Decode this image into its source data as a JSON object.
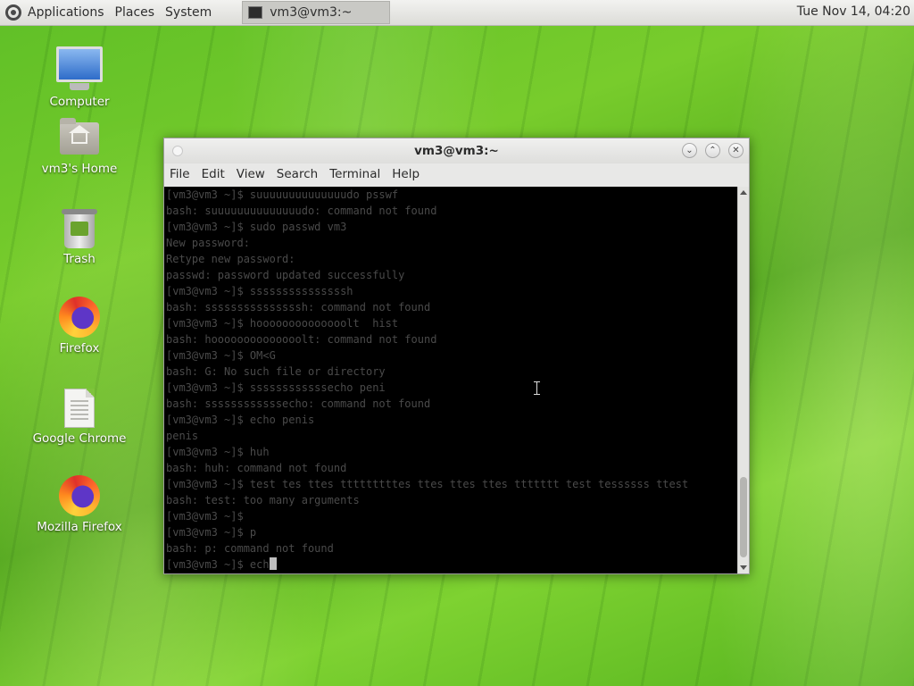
{
  "panel": {
    "menus": [
      "Applications",
      "Places",
      "System"
    ],
    "task_title": "vm3@vm3:~",
    "clock": "Tue Nov 14, 04:20"
  },
  "desktop": {
    "icons": [
      {
        "label": "Computer",
        "icon": "computer-icon"
      },
      {
        "label": "vm3's Home",
        "icon": "home-folder-icon"
      },
      {
        "label": "Trash",
        "icon": "trash-icon"
      },
      {
        "label": "Firefox",
        "icon": "firefox-icon"
      },
      {
        "label": "Google Chrome",
        "icon": "document-icon"
      },
      {
        "label": "Mozilla Firefox",
        "icon": "firefox-icon"
      }
    ]
  },
  "terminal": {
    "title": "vm3@vm3:~",
    "menu": [
      "File",
      "Edit",
      "View",
      "Search",
      "Terminal",
      "Help"
    ],
    "lines": [
      "[vm3@vm3 ~]$ suuuuuuuuuuuuuudo psswf",
      "bash: suuuuuuuuuuuuuudo: command not found",
      "[vm3@vm3 ~]$ sudo passwd vm3",
      "New password:",
      "Retype new password:",
      "passwd: password updated successfully",
      "[vm3@vm3 ~]$ sssssssssssssssh",
      "bash: sssssssssssssssh: command not found",
      "[vm3@vm3 ~]$ hoooooooooooooolt  hist",
      "bash: hoooooooooooooolt: command not found",
      "[vm3@vm3 ~]$ OM<G",
      "bash: G: No such file or directory",
      "[vm3@vm3 ~]$ ssssssssssssecho peni",
      "bash: ssssssssssssecho: command not found",
      "[vm3@vm3 ~]$ echo penis",
      "penis",
      "[vm3@vm3 ~]$ huh",
      "bash: huh: command not found",
      "[vm3@vm3 ~]$ test tes ttes tttttttttes ttes ttes ttes ttttttt test tessssss ttest",
      "bash: test: too many arguments",
      "[vm3@vm3 ~]$",
      "[vm3@vm3 ~]$ p",
      "bash: p: command not found"
    ],
    "current_line": "[vm3@vm3 ~]$ ech"
  }
}
